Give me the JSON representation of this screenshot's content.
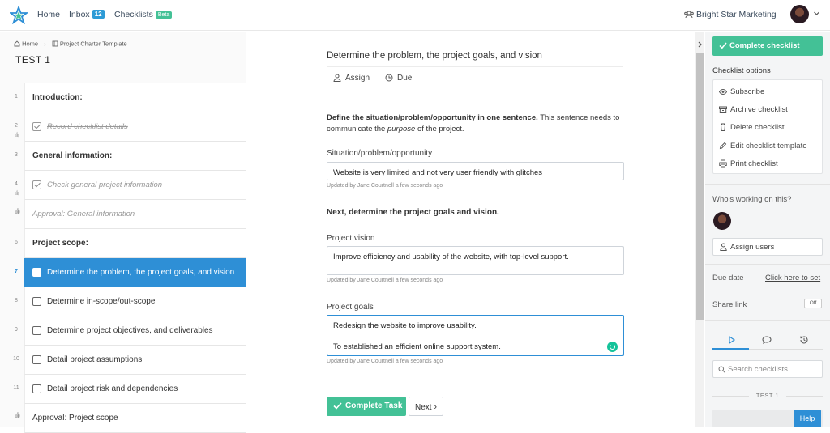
{
  "topbar": {
    "nav": [
      {
        "label": "Home"
      },
      {
        "label": "Inbox",
        "badge": "12"
      },
      {
        "label": "Checklists",
        "tag": "Beta"
      }
    ],
    "org_name": "Bright Star Marketing",
    "accent_color": "#2e8fd6",
    "success_color": "#43c196"
  },
  "breadcrumb": [
    "Home",
    "Project Charter Template"
  ],
  "checklist_title": "TEST 1",
  "tasks": [
    {
      "num": "1",
      "label": "Introduction:",
      "kind": "heading"
    },
    {
      "num": "2",
      "label": "Record checklist details",
      "kind": "done"
    },
    {
      "num": "3",
      "label": "General information:",
      "kind": "heading"
    },
    {
      "num": "4",
      "label": "Check general project information",
      "kind": "done"
    },
    {
      "num": "",
      "label": "Approval: General information",
      "kind": "approval-done"
    },
    {
      "num": "6",
      "label": "Project scope:",
      "kind": "heading"
    },
    {
      "num": "7",
      "label": "Determine the problem, the project goals, and vision",
      "kind": "active"
    },
    {
      "num": "8",
      "label": "Determine in-scope/out-scope",
      "kind": "todo"
    },
    {
      "num": "9",
      "label": "Determine project objectives, and deliverables",
      "kind": "todo"
    },
    {
      "num": "10",
      "label": "Detail project assumptions",
      "kind": "todo"
    },
    {
      "num": "11",
      "label": "Detail project risk and dependencies",
      "kind": "todo"
    },
    {
      "num": "",
      "label": "Approval: Project scope",
      "kind": "approval"
    }
  ],
  "task": {
    "title": "Determine the problem, the project goals, and vision",
    "assign_label": "Assign",
    "due_label": "Due",
    "intro_bold": "Define the situation/problem/opportunity in one sentence.",
    "intro_rest_1": " This sentence needs to communicate the ",
    "intro_em": "purpose",
    "intro_rest_2": " of the project.",
    "field1_label": "Situation/problem/opportunity",
    "field1_value": "Website is very limited and not very user friendly with glitches",
    "updated_note": "Updated by Jane Courtnell a few seconds ago",
    "section2_heading": "Next, determine the project goals and vision.",
    "field2_label": "Project vision",
    "field2_value": "Improve efficiency and usability of the website, with top-level support.",
    "field3_label": "Project goals",
    "field3_line1": "Redesign the website to improve usability.",
    "field3_line2": "To established an efficient online support system.",
    "complete_button": "Complete Task",
    "next_button": "Next"
  },
  "sidebar": {
    "complete_checklist": "Complete checklist",
    "options_heading": "Checklist options",
    "options": [
      {
        "label": "Subscribe",
        "icon": "eye-icon"
      },
      {
        "label": "Archive checklist",
        "icon": "archive-icon"
      },
      {
        "label": "Delete checklist",
        "icon": "trash-icon"
      },
      {
        "label": "Edit checklist template",
        "icon": "pencil-icon"
      },
      {
        "label": "Print checklist",
        "icon": "printer-icon"
      }
    ],
    "working_heading": "Who's working on this?",
    "assign_users": "Assign users",
    "due_date_label": "Due date",
    "due_date_link": "Click here to set",
    "share_link_label": "Share link",
    "share_toggle": "Off",
    "search_placeholder": "Search checklists",
    "list_heading": "TEST 1",
    "help_button": "Help"
  }
}
